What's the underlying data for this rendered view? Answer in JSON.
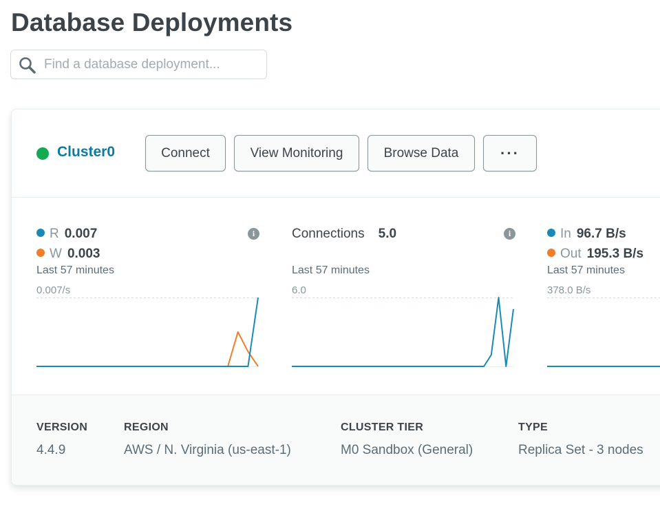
{
  "page": {
    "title": "Database Deployments"
  },
  "search": {
    "placeholder": "Find a database deployment...",
    "value": ""
  },
  "cluster": {
    "name": "Cluster0",
    "status_color": "#13aa52",
    "buttons": {
      "connect": "Connect",
      "view_monitoring": "View Monitoring",
      "browse_data": "Browse Data",
      "more": "···"
    }
  },
  "metrics": {
    "operations": {
      "r_label": "R",
      "r_value": "0.007",
      "w_label": "W",
      "w_value": "0.003",
      "period": "Last 57 minutes",
      "max": "0.007/s",
      "colors": {
        "r": "#1a8ab5",
        "w": "#f07d2a"
      }
    },
    "connections": {
      "label": "Connections",
      "value": "5.0",
      "period": "Last 57 minutes",
      "max": "6.0",
      "color": "#1a8ab5"
    },
    "network": {
      "in_label": "In",
      "in_value": "96.7 B/s",
      "out_label": "Out",
      "out_value": "195.3 B/s",
      "period": "Last 57 minutes",
      "max": "378.0 B/s",
      "colors": {
        "in": "#1a8ab5",
        "out": "#f07d2a"
      }
    }
  },
  "chart_data": [
    {
      "type": "line",
      "title": "",
      "xlabel": "",
      "ylabel": "",
      "ylim": [
        0,
        0.007
      ],
      "series": [
        {
          "name": "R",
          "values": [
            0,
            0,
            0,
            0,
            0,
            0,
            0,
            0,
            0,
            0,
            0,
            0,
            0,
            0,
            0,
            0,
            0,
            0,
            0,
            0,
            0,
            0,
            0.007
          ]
        },
        {
          "name": "W",
          "values": [
            0,
            0,
            0,
            0,
            0,
            0,
            0,
            0,
            0,
            0,
            0,
            0,
            0,
            0,
            0,
            0,
            0,
            0,
            0,
            0,
            0.0035,
            0.0015,
            0
          ]
        }
      ]
    },
    {
      "type": "line",
      "title": "",
      "xlabel": "",
      "ylabel": "",
      "ylim": [
        0,
        6
      ],
      "series": [
        {
          "name": "Connections",
          "values": [
            0,
            0,
            0,
            0,
            0,
            0,
            0,
            0,
            0,
            0,
            0,
            0,
            0,
            0,
            0,
            0,
            0,
            0,
            0,
            0,
            0,
            0,
            0,
            0,
            0,
            0,
            0,
            1,
            6,
            0,
            5
          ]
        }
      ]
    },
    {
      "type": "line",
      "title": "",
      "xlabel": "",
      "ylabel": "",
      "ylim": [
        0,
        378
      ],
      "series": [
        {
          "name": "In",
          "values": [
            0,
            0,
            0,
            0,
            0,
            0,
            0,
            0
          ]
        },
        {
          "name": "Out",
          "values": [
            0,
            0,
            0,
            0,
            0,
            0,
            0,
            0
          ]
        }
      ]
    }
  ],
  "details": {
    "version": {
      "title": "VERSION",
      "value": "4.4.9"
    },
    "region": {
      "title": "REGION",
      "value": "AWS / N. Virginia (us-east-1)"
    },
    "tier": {
      "title": "CLUSTER TIER",
      "value": "M0 Sandbox (General)"
    },
    "type": {
      "title": "TYPE",
      "value": "Replica Set - 3 nodes"
    }
  }
}
